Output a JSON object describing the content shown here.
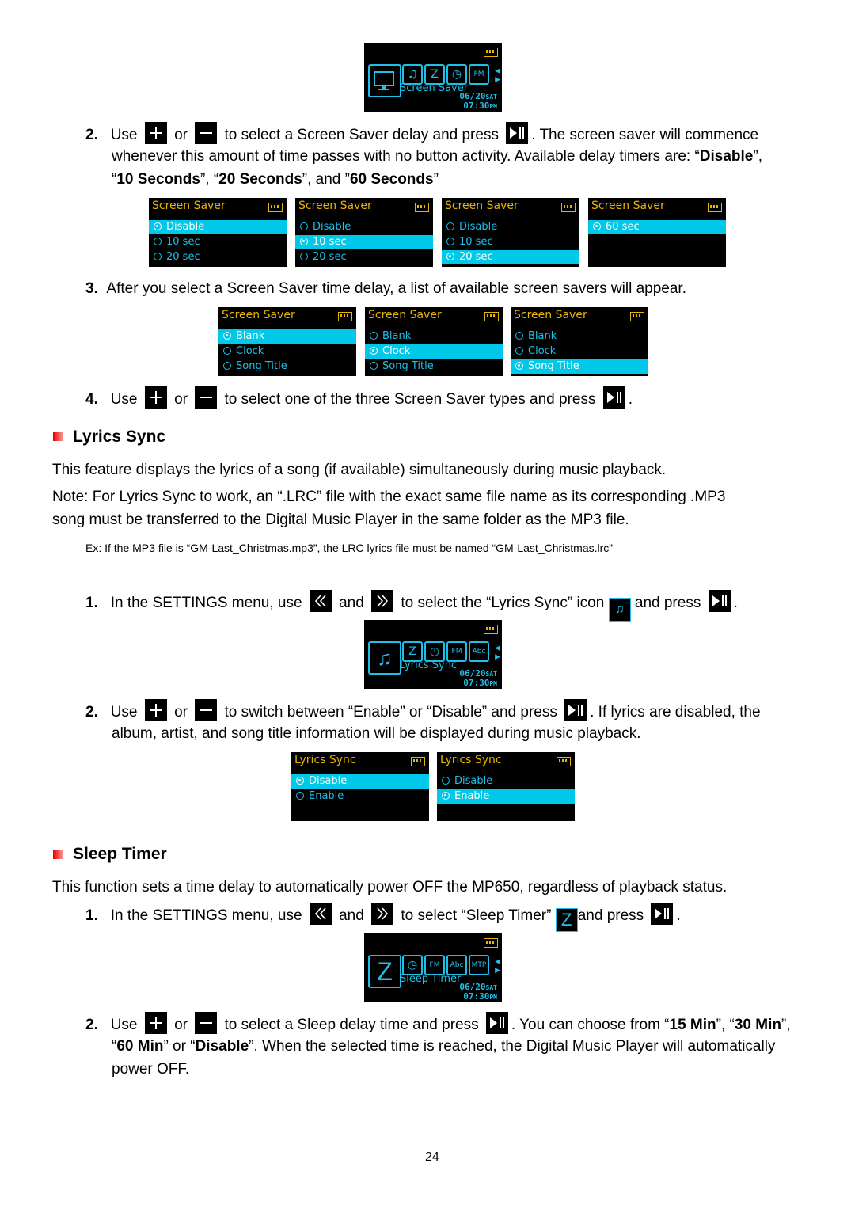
{
  "screen_saver_menu": {
    "label": "Screen Saver",
    "date": "06/20",
    "day": "SAT",
    "time": "07:30",
    "ampm": "PM",
    "sub_icons": [
      "lyrics-icon",
      "sleep-timer-icon",
      "clock-icon",
      "fm-icon"
    ]
  },
  "step2_ss": {
    "num": "2.",
    "t1": "Use",
    "t2": "or",
    "t3": "to select a Screen Saver delay and press",
    "t4": ". The screen saver will commence",
    "line2": "whenever this amount of time passes with no button activity. Available delay timers are: “",
    "b_disable": "Disable",
    "line2_end": "”,",
    "l3_a": "“",
    "b_10": "10 Seconds",
    "l3_b": "”, “",
    "b_20": "20 Seconds",
    "l3_c": "”, and ”",
    "b_60": "60 Seconds",
    "l3_d": "”"
  },
  "delay_screens": [
    {
      "title": "Screen Saver",
      "options": [
        {
          "label": "Disable",
          "selected": true
        },
        {
          "label": "10 sec",
          "selected": false
        },
        {
          "label": "20 sec",
          "selected": false
        }
      ]
    },
    {
      "title": "Screen Saver",
      "options": [
        {
          "label": "Disable",
          "selected": false
        },
        {
          "label": "10 sec",
          "selected": true
        },
        {
          "label": "20 sec",
          "selected": false
        }
      ]
    },
    {
      "title": "Screen Saver",
      "options": [
        {
          "label": "Disable",
          "selected": false
        },
        {
          "label": "10 sec",
          "selected": false
        },
        {
          "label": "20 sec",
          "selected": true
        }
      ]
    },
    {
      "title": "Screen Saver",
      "options": [
        {
          "label": "60 sec",
          "selected": true
        }
      ]
    }
  ],
  "step3_ss": {
    "num": "3.",
    "text": "After you select a Screen Saver time delay, a list of available screen savers will appear."
  },
  "type_screens": [
    {
      "title": "Screen Saver",
      "options": [
        {
          "label": "Blank",
          "selected": true
        },
        {
          "label": "Clock",
          "selected": false
        },
        {
          "label": "Song Title",
          "selected": false
        }
      ]
    },
    {
      "title": "Screen Saver",
      "options": [
        {
          "label": "Blank",
          "selected": false
        },
        {
          "label": "Clock",
          "selected": true
        },
        {
          "label": "Song Title",
          "selected": false
        }
      ]
    },
    {
      "title": "Screen Saver",
      "options": [
        {
          "label": "Blank",
          "selected": false
        },
        {
          "label": "Clock",
          "selected": false
        },
        {
          "label": "Song Title",
          "selected": true
        }
      ]
    }
  ],
  "step4_ss": {
    "num": "4.",
    "t1": "Use",
    "t2": "or",
    "t3": "to select one of the three Screen Saver types and press",
    "t4": "."
  },
  "lyrics_section": {
    "heading": "Lyrics Sync",
    "intro": "This feature displays the lyrics of a song (if available) simultaneously during music playback.",
    "note_l1": "Note: For Lyrics Sync to work, an “.LRC” file with the exact same file name as its corresponding .MP3",
    "note_l2": "song must be transferred to the Digital Music Player in the same folder as the MP3 file.",
    "example": "Ex: If the MP3 file is “GM-Last_Christmas.mp3”, the LRC lyrics file must be named “GM-Last_Christmas.lrc”",
    "step1": {
      "num": "1.",
      "t1": "In the SETTINGS menu, use",
      "t2": "and",
      "t3": "to select the “Lyrics Sync” icon",
      "t4": "and press",
      "t5": "."
    },
    "menu": {
      "label": "Lyrics Sync",
      "date": "06/20",
      "day": "SAT",
      "time": "07:30",
      "ampm": "PM",
      "sub_icons": [
        "sleep-timer-icon",
        "clock-icon",
        "fm-icon",
        "abc-icon"
      ]
    },
    "step2": {
      "num": "2.",
      "t1": "Use",
      "t2": "or",
      "t3": "to switch between “Enable” or “Disable” and press",
      "t4": ". If lyrics are disabled, the",
      "line2": "album, artist, and song title information will be displayed during music playback."
    },
    "screens": [
      {
        "title": "Lyrics Sync",
        "options": [
          {
            "label": "Disable",
            "selected": true
          },
          {
            "label": "Enable",
            "selected": false
          }
        ]
      },
      {
        "title": "Lyrics Sync",
        "options": [
          {
            "label": "Disable",
            "selected": false
          },
          {
            "label": "Enable",
            "selected": true
          }
        ]
      }
    ]
  },
  "sleep_section": {
    "heading": "Sleep Timer",
    "intro": "This function sets a time delay to automatically power OFF the MP650, regardless of playback status.",
    "step1": {
      "num": "1.",
      "t1": "In the SETTINGS menu, use",
      "t2": "and",
      "t3": "to select “Sleep Timer”",
      "t4": "and press",
      "t5": "."
    },
    "menu": {
      "label": "Sleep Timer",
      "date": "06/20",
      "day": "SAT",
      "time": "07:30",
      "ampm": "PM",
      "sub_icons": [
        "clock-icon",
        "fm-icon",
        "abc-icon",
        "mtp-icon"
      ]
    },
    "step2": {
      "num": "2.",
      "t1": "Use",
      "t2": "or",
      "t3": "to select a Sleep delay time and press",
      "t4": ". You can choose from “",
      "b15": "15 Min",
      "t5": "”, “",
      "b30": "30 Min",
      "t6": "”,",
      "l2a": "“",
      "b60": "60 Min",
      "l2b": "” or “",
      "bdis": "Disable",
      "l2c": "”. When the selected time is reached, the Digital Music Player will automatically",
      "line3": "power OFF."
    }
  },
  "page_number": "24"
}
